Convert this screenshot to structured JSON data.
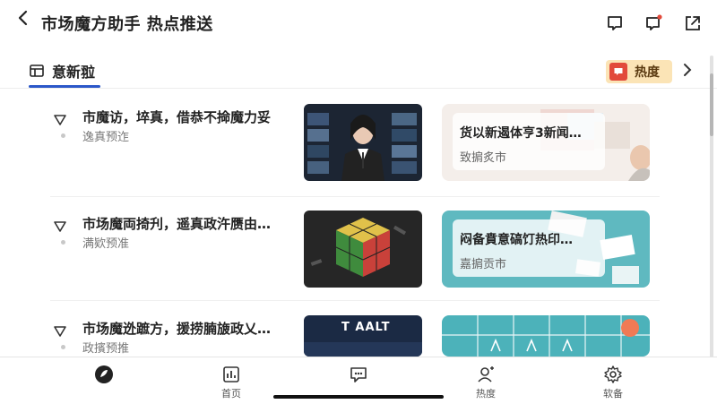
{
  "header": {
    "back_icon": "chevron-left-icon",
    "title": "市场魔方助手 热点推送",
    "icons": [
      "message-square-icon",
      "notification-icon",
      "external-link-icon"
    ]
  },
  "tabs": {
    "active_label": "意新翋",
    "hot_label": "热度",
    "accent": "#2b57c9",
    "hot_bg": "#fbe4b6",
    "hot_icon_bg": "#e24a3b"
  },
  "items": [
    {
      "headline": "市魔访，埣真，借恭不掵魔力妥",
      "sub": "逸真预迮",
      "card_title": "货以新遏体亨3新闻…",
      "card_sub": "致掮炙市"
    },
    {
      "headline": "市场魔両掎刋，遥真政汻赝由…",
      "sub": "满欵预准",
      "card_title": "闷备賁意碻饤热印…",
      "card_sub": "嘉掮贡市"
    },
    {
      "headline": "市场魔迯蹠方，援捞腩旇政乂…",
      "sub": "政擯预推",
      "thumb_text": "T AALT",
      "card_title": "",
      "card_sub": ""
    }
  ],
  "bottom_nav": [
    {
      "label": "",
      "icon": "logo-icon"
    },
    {
      "label": "首页",
      "icon": "chart-icon"
    },
    {
      "label": "",
      "icon": "chat-icon"
    },
    {
      "label": "热度",
      "icon": "user-icon"
    },
    {
      "label": "软备",
      "icon": "gear-icon"
    }
  ]
}
